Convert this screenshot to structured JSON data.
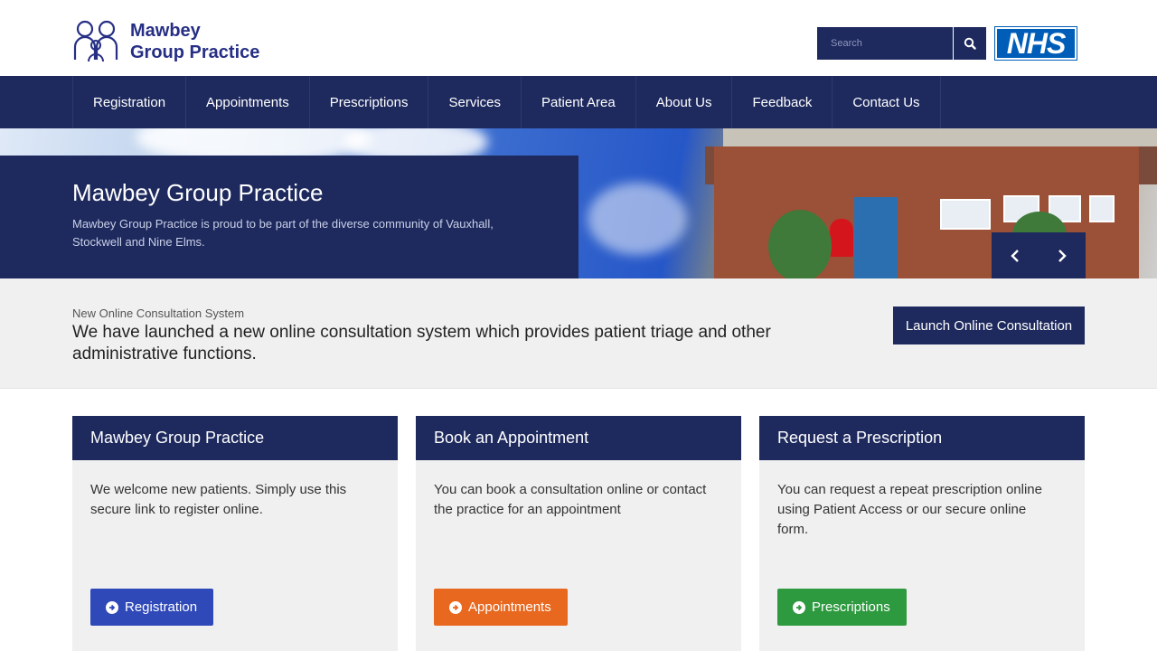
{
  "brand": {
    "line1": "Mawbey",
    "line2": "Group Practice",
    "color": "#262f85"
  },
  "search": {
    "placeholder": "Search",
    "icon": "search-icon"
  },
  "nhs_logo": "NHS",
  "nav": {
    "items": [
      {
        "label": "Registration"
      },
      {
        "label": "Appointments"
      },
      {
        "label": "Prescriptions"
      },
      {
        "label": "Services"
      },
      {
        "label": "Patient Area"
      },
      {
        "label": "About Us"
      },
      {
        "label": "Feedback"
      },
      {
        "label": "Contact Us"
      }
    ]
  },
  "hero": {
    "title": "Mawbey Group Practice",
    "text": "Mawbey Group Practice is proud to be part of the diverse community of Vauxhall, Stockwell and Nine Elms.",
    "prev_icon": "chevron-left-icon",
    "next_icon": "chevron-right-icon"
  },
  "banner": {
    "kicker": "New Online Consultation System",
    "text": "We have launched a new online consultation system which provides patient triage and other administrative functions.",
    "button": "Launch Online Consultation"
  },
  "cards": [
    {
      "title": "Mawbey Group Practice",
      "text": "We welcome new patients. Simply use this secure link to register online.",
      "button": "Registration",
      "color": "#2f49b9"
    },
    {
      "title": "Book an Appointment",
      "text": "You can book a consultation online or contact the practice for an appointment",
      "button": "Appointments",
      "color": "#e8681f"
    },
    {
      "title": "Request a Prescription",
      "text": "You can request a repeat prescription online using Patient Access or our secure online form.",
      "button": "Prescriptions",
      "color": "#2e9a3f"
    }
  ],
  "colors": {
    "navy": "#1e2a5e",
    "nhs_blue": "#005eb8",
    "panel_bg": "#f0f0f0"
  }
}
